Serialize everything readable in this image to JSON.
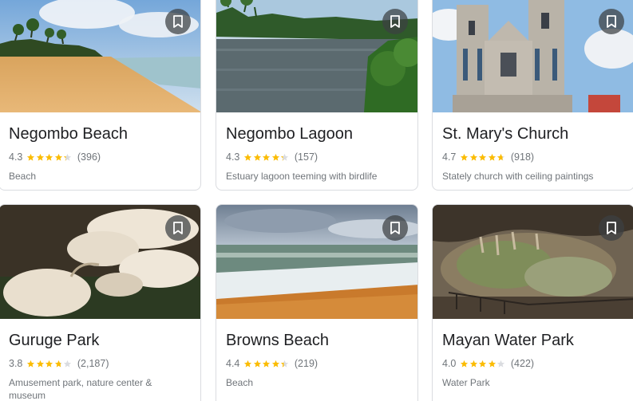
{
  "colors": {
    "star": "#fbbc04",
    "star_empty": "#dadce0",
    "text": "#202124",
    "subtext": "#70757a"
  },
  "places": [
    {
      "name": "Negombo Beach",
      "rating": "4.3",
      "rating_value": 4.3,
      "reviews": "(396)",
      "category": "Beach",
      "save_icon": "bookmark-icon"
    },
    {
      "name": "Negombo Lagoon",
      "rating": "4.3",
      "rating_value": 4.3,
      "reviews": "(157)",
      "category": "Estuary lagoon teeming with birdlife",
      "save_icon": "bookmark-icon"
    },
    {
      "name": "St. Mary's Church",
      "rating": "4.7",
      "rating_value": 4.7,
      "reviews": "(918)",
      "category": "Stately church with ceiling paintings",
      "save_icon": "bookmark-icon"
    },
    {
      "name": "Guruge Park",
      "rating": "3.8",
      "rating_value": 3.8,
      "reviews": "(2,187)",
      "category": "Amusement park, nature center & museum",
      "save_icon": "bookmark-icon"
    },
    {
      "name": "Browns Beach",
      "rating": "4.4",
      "rating_value": 4.4,
      "reviews": "(219)",
      "category": "Beach",
      "save_icon": "bookmark-icon"
    },
    {
      "name": "Mayan Water Park",
      "rating": "4.0",
      "rating_value": 4.0,
      "reviews": "(422)",
      "category": "Water Park",
      "save_icon": "bookmark-icon"
    }
  ]
}
